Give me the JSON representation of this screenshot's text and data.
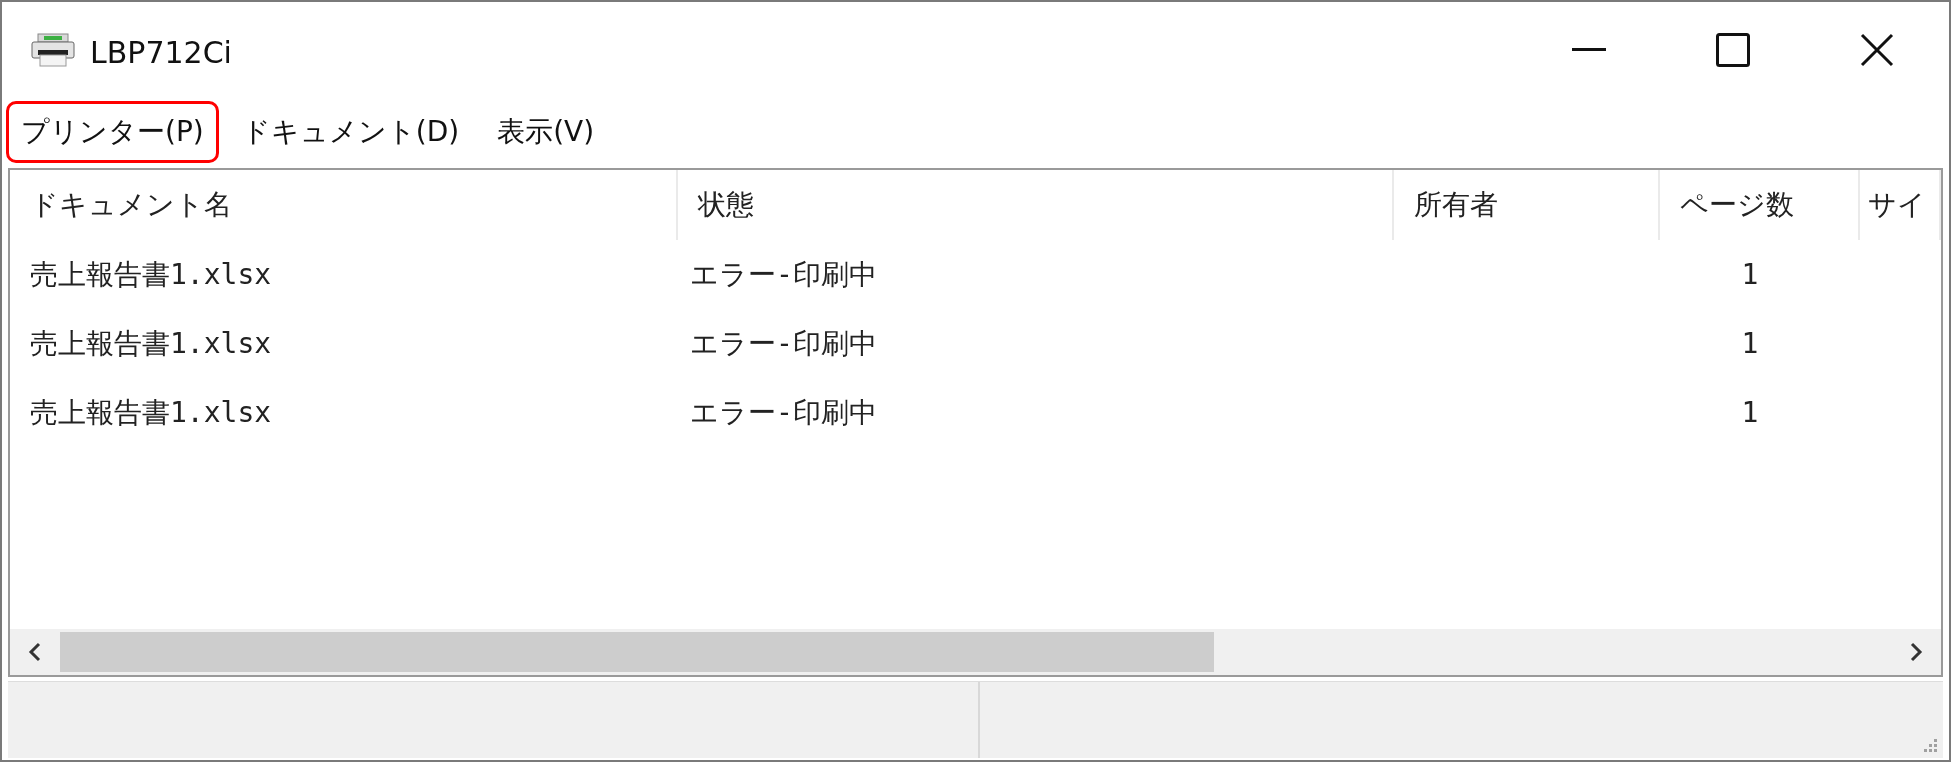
{
  "window": {
    "title": "LBP712Ci"
  },
  "menu": [
    {
      "label": "プリンター(P)",
      "highlighted": true
    },
    {
      "label": "ドキュメント(D)",
      "highlighted": false
    },
    {
      "label": "表示(V)",
      "highlighted": false
    }
  ],
  "table": {
    "columns": [
      "ドキュメント名",
      "状態",
      "所有者",
      "ページ数",
      "サイ"
    ],
    "rows": [
      {
        "document_name": "売上報告書1.xlsx",
        "status": "エラー-印刷中",
        "pages": "1"
      },
      {
        "document_name": "売上報告書1.xlsx",
        "status": "エラー-印刷中",
        "pages": "1"
      },
      {
        "document_name": "売上報告書1.xlsx",
        "status": "エラー-印刷中",
        "pages": "1"
      }
    ]
  }
}
